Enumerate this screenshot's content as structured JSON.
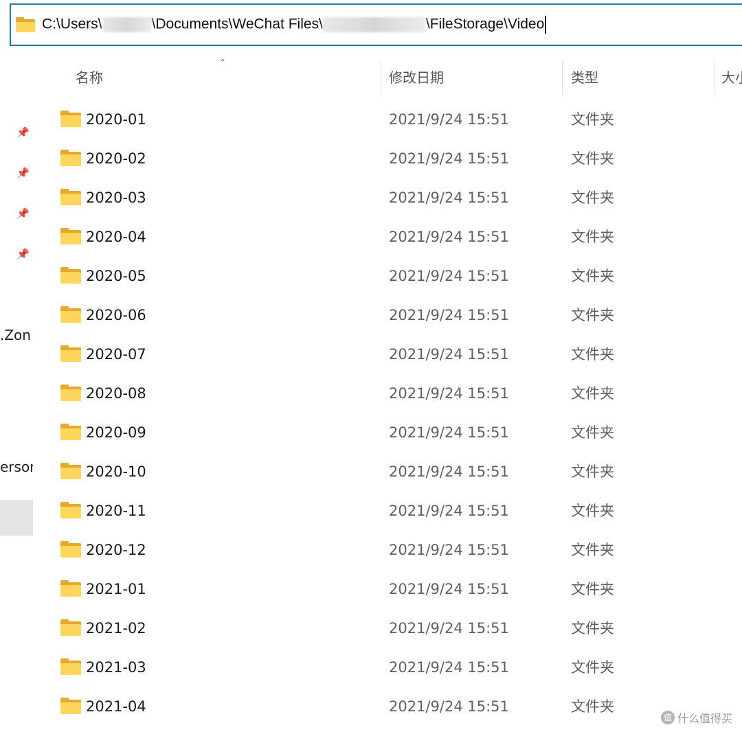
{
  "address_bar": {
    "path_prefix": "C:\\Users\\",
    "path_part_2": "\\Documents\\WeChat Files\\",
    "path_part_3": "\\FileStorage\\Video"
  },
  "nav": {
    "items": [
      {
        "label": ".Zon"
      },
      {
        "label": "ersor"
      }
    ]
  },
  "columns": {
    "name": "名称",
    "modified": "修改日期",
    "type": "类型",
    "size": "大小"
  },
  "files": [
    {
      "name": "2020-01",
      "modified": "2021/9/24 15:51",
      "type": "文件夹"
    },
    {
      "name": "2020-02",
      "modified": "2021/9/24 15:51",
      "type": "文件夹"
    },
    {
      "name": "2020-03",
      "modified": "2021/9/24 15:51",
      "type": "文件夹"
    },
    {
      "name": "2020-04",
      "modified": "2021/9/24 15:51",
      "type": "文件夹"
    },
    {
      "name": "2020-05",
      "modified": "2021/9/24 15:51",
      "type": "文件夹"
    },
    {
      "name": "2020-06",
      "modified": "2021/9/24 15:51",
      "type": "文件夹"
    },
    {
      "name": "2020-07",
      "modified": "2021/9/24 15:51",
      "type": "文件夹"
    },
    {
      "name": "2020-08",
      "modified": "2021/9/24 15:51",
      "type": "文件夹"
    },
    {
      "name": "2020-09",
      "modified": "2021/9/24 15:51",
      "type": "文件夹"
    },
    {
      "name": "2020-10",
      "modified": "2021/9/24 15:51",
      "type": "文件夹"
    },
    {
      "name": "2020-11",
      "modified": "2021/9/24 15:51",
      "type": "文件夹"
    },
    {
      "name": "2020-12",
      "modified": "2021/9/24 15:51",
      "type": "文件夹"
    },
    {
      "name": "2021-01",
      "modified": "2021/9/24 15:51",
      "type": "文件夹"
    },
    {
      "name": "2021-02",
      "modified": "2021/9/24 15:51",
      "type": "文件夹"
    },
    {
      "name": "2021-03",
      "modified": "2021/9/24 15:51",
      "type": "文件夹"
    },
    {
      "name": "2021-04",
      "modified": "2021/9/24 15:51",
      "type": "文件夹"
    }
  ],
  "watermark": {
    "text": "什么值得买",
    "icon": "值"
  },
  "colors": {
    "address_border": "#1e7ea0",
    "folder_front": "#ffd65c",
    "folder_back": "#e6a92a",
    "secondary_text": "#606060"
  }
}
